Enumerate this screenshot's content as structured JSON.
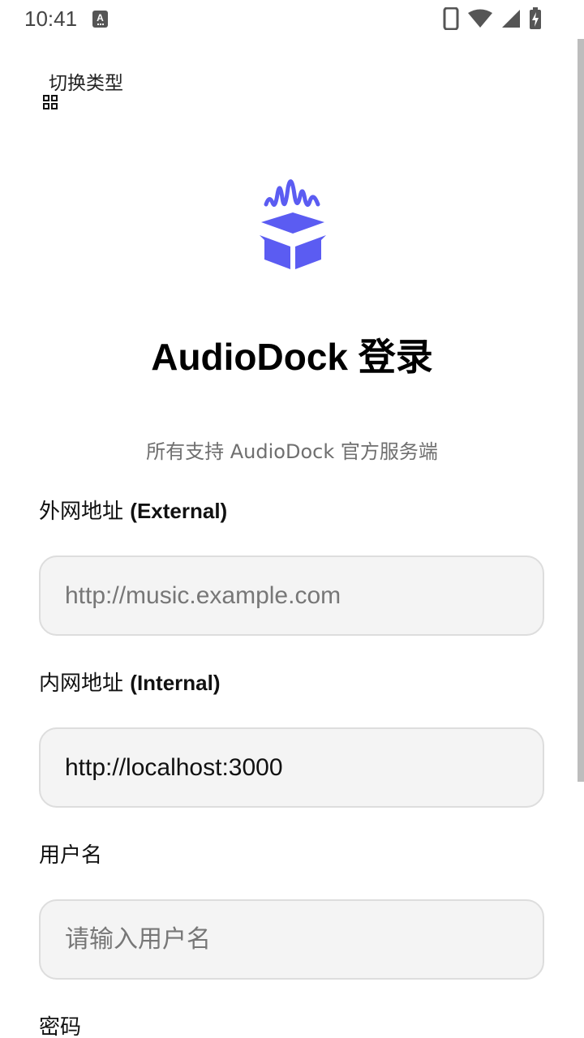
{
  "status_bar": {
    "time": "10:41",
    "icons": [
      "a-notification-icon",
      "phone-icon",
      "wifi-icon",
      "cell-signal-icon",
      "battery-charging-icon"
    ]
  },
  "header": {
    "switch_type_label": "切换类型",
    "switch_type_icon": "grid-icon"
  },
  "logo": {
    "icon": "audio-box-logo-icon",
    "color": "#5b5cf2"
  },
  "main": {
    "title": "AudioDock 登录",
    "subtitle": "所有支持 AudioDock 官方服务端"
  },
  "form": {
    "external": {
      "label_zh": "外网地址",
      "label_en": "(External)",
      "value": "",
      "placeholder": "http://music.example.com"
    },
    "internal": {
      "label_zh": "内网地址",
      "label_en": "(Internal)",
      "value": "http://localhost:3000",
      "placeholder": ""
    },
    "username": {
      "label": "用户名",
      "value": "",
      "placeholder": "请输入用户名"
    },
    "password": {
      "label": "密码"
    }
  }
}
